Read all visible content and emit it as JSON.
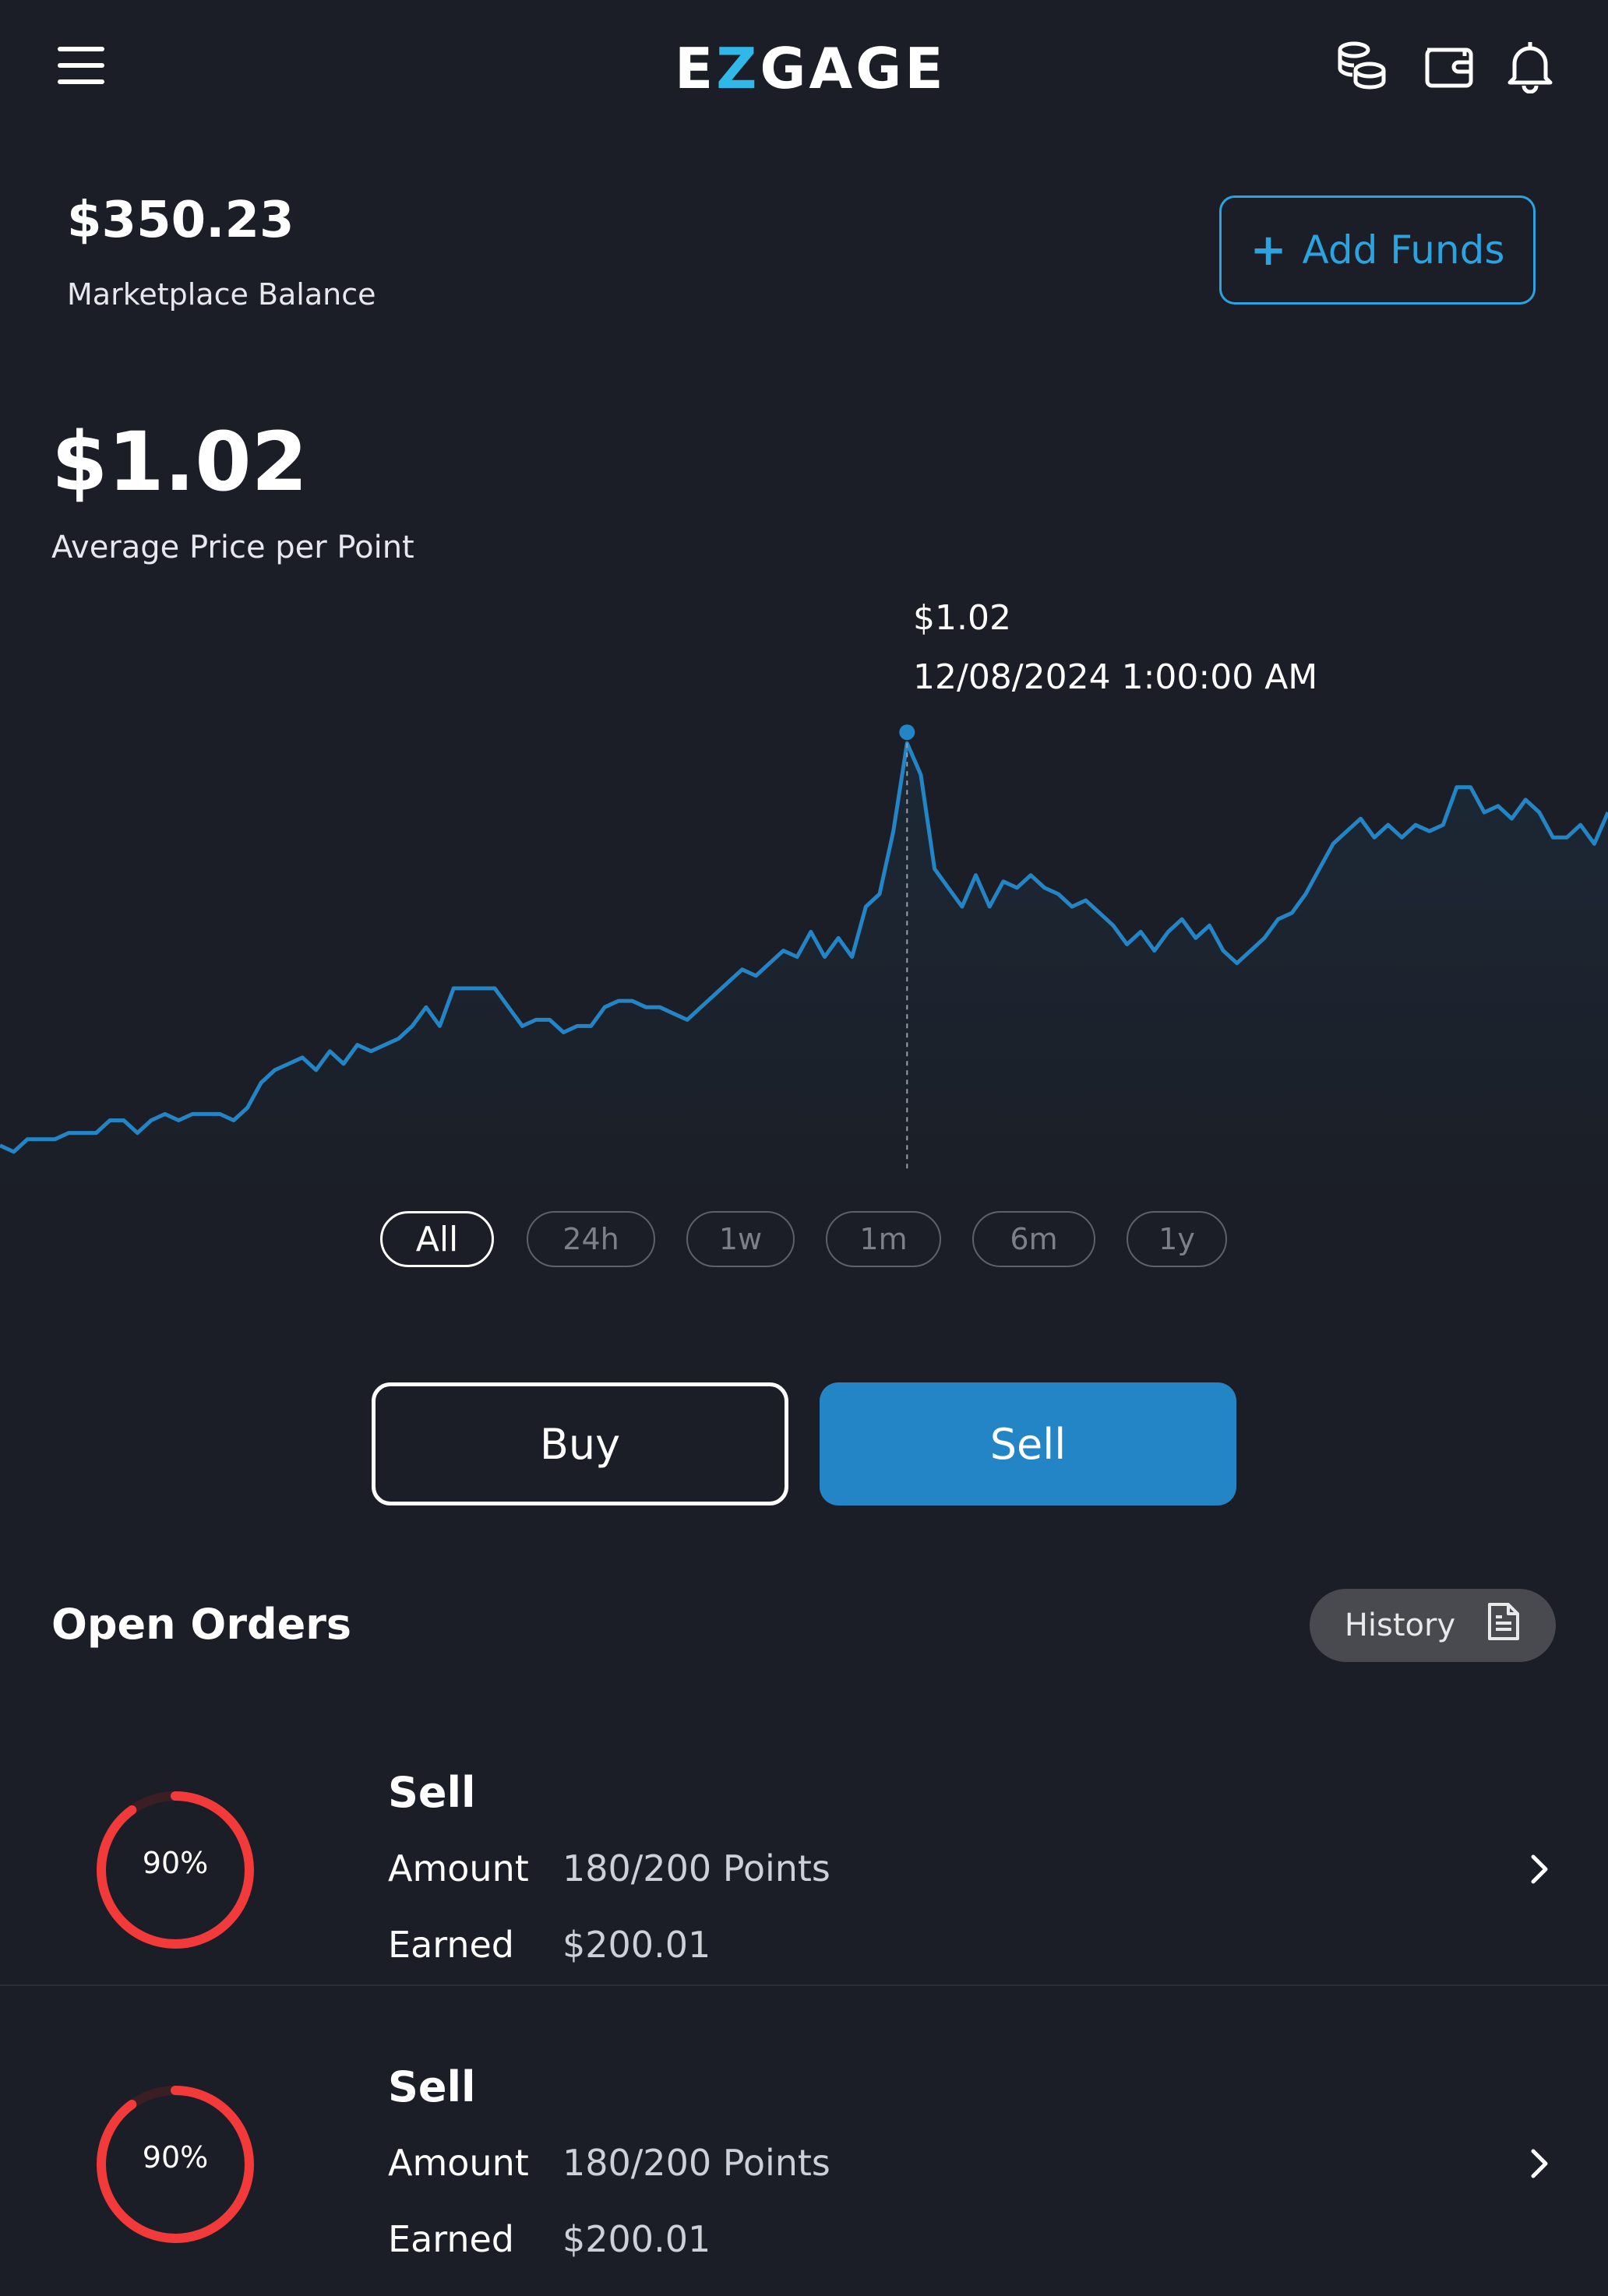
{
  "header": {
    "logo_prefix": "E",
    "logo_z": "Z",
    "logo_suffix": "GAGE",
    "icons": [
      "menu-icon",
      "coins-icon",
      "wallet-icon",
      "bell-icon"
    ]
  },
  "balance": {
    "value": "$350.23",
    "label": "Marketplace Balance",
    "add_funds_plus": "+",
    "add_funds_label": "Add Funds"
  },
  "average": {
    "value": "$1.02",
    "label": "Average Price per Point"
  },
  "chart_data": {
    "type": "line",
    "title": "",
    "xlabel": "",
    "ylabel": "",
    "grid": false,
    "tooltip": {
      "value": "$1.02",
      "date": "12/08/2024 1:00:00 AM"
    },
    "color": "#2385c6",
    "series": [
      {
        "values": [
          0.38,
          0.37,
          0.39,
          0.39,
          0.39,
          0.4,
          0.4,
          0.4,
          0.42,
          0.42,
          0.4,
          0.42,
          0.43,
          0.42,
          0.43,
          0.43,
          0.43,
          0.42,
          0.44,
          0.48,
          0.5,
          0.51,
          0.52,
          0.5,
          0.53,
          0.51,
          0.54,
          0.53,
          0.54,
          0.55,
          0.57,
          0.6,
          0.57,
          0.63,
          0.63,
          0.63,
          0.63,
          0.6,
          0.57,
          0.58,
          0.58,
          0.56,
          0.57,
          0.57,
          0.6,
          0.61,
          0.61,
          0.6,
          0.6,
          0.59,
          0.58,
          0.6,
          0.62,
          0.64,
          0.66,
          0.65,
          0.67,
          0.69,
          0.68,
          0.72,
          0.68,
          0.71,
          0.68,
          0.76,
          0.78,
          0.88,
          1.02,
          0.97,
          0.82,
          0.79,
          0.76,
          0.81,
          0.76,
          0.8,
          0.79,
          0.81,
          0.79,
          0.78,
          0.76,
          0.77,
          0.75,
          0.73,
          0.7,
          0.72,
          0.69,
          0.72,
          0.74,
          0.71,
          0.73,
          0.69,
          0.67,
          0.69,
          0.71,
          0.74,
          0.75,
          0.78,
          0.82,
          0.86,
          0.88,
          0.9,
          0.87,
          0.89,
          0.87,
          0.89,
          0.88,
          0.89,
          0.95,
          0.95,
          0.91,
          0.92,
          0.9,
          0.93,
          0.91,
          0.87,
          0.87,
          0.89,
          0.86,
          0.91
        ]
      }
    ],
    "marker_index": 66
  },
  "ranges": {
    "items": [
      {
        "label": "All",
        "active": true
      },
      {
        "label": "24h",
        "active": false
      },
      {
        "label": "1w",
        "active": false
      },
      {
        "label": "1m",
        "active": false
      },
      {
        "label": "6m",
        "active": false
      },
      {
        "label": "1y",
        "active": false
      }
    ]
  },
  "actions": {
    "buy_label": "Buy",
    "sell_label": "Sell"
  },
  "orders": {
    "title": "Open Orders",
    "history_label": "History",
    "items": [
      {
        "type": "Sell",
        "progress_label": "90%",
        "progress": 0.9,
        "amount_label": "Amount",
        "amount_value": "180/200 Points",
        "earned_label": "Earned",
        "earned_value": "$200.01"
      },
      {
        "type": "Sell",
        "progress_label": "90%",
        "progress": 0.9,
        "amount_label": "Amount",
        "amount_value": "180/200 Points",
        "earned_label": "Earned",
        "earned_value": "$200.01"
      }
    ]
  },
  "colors": {
    "accent": "#2385c6",
    "outline_accent": "#2aa3e0",
    "progress": "#f23a3a",
    "background": "#1b1e26"
  }
}
